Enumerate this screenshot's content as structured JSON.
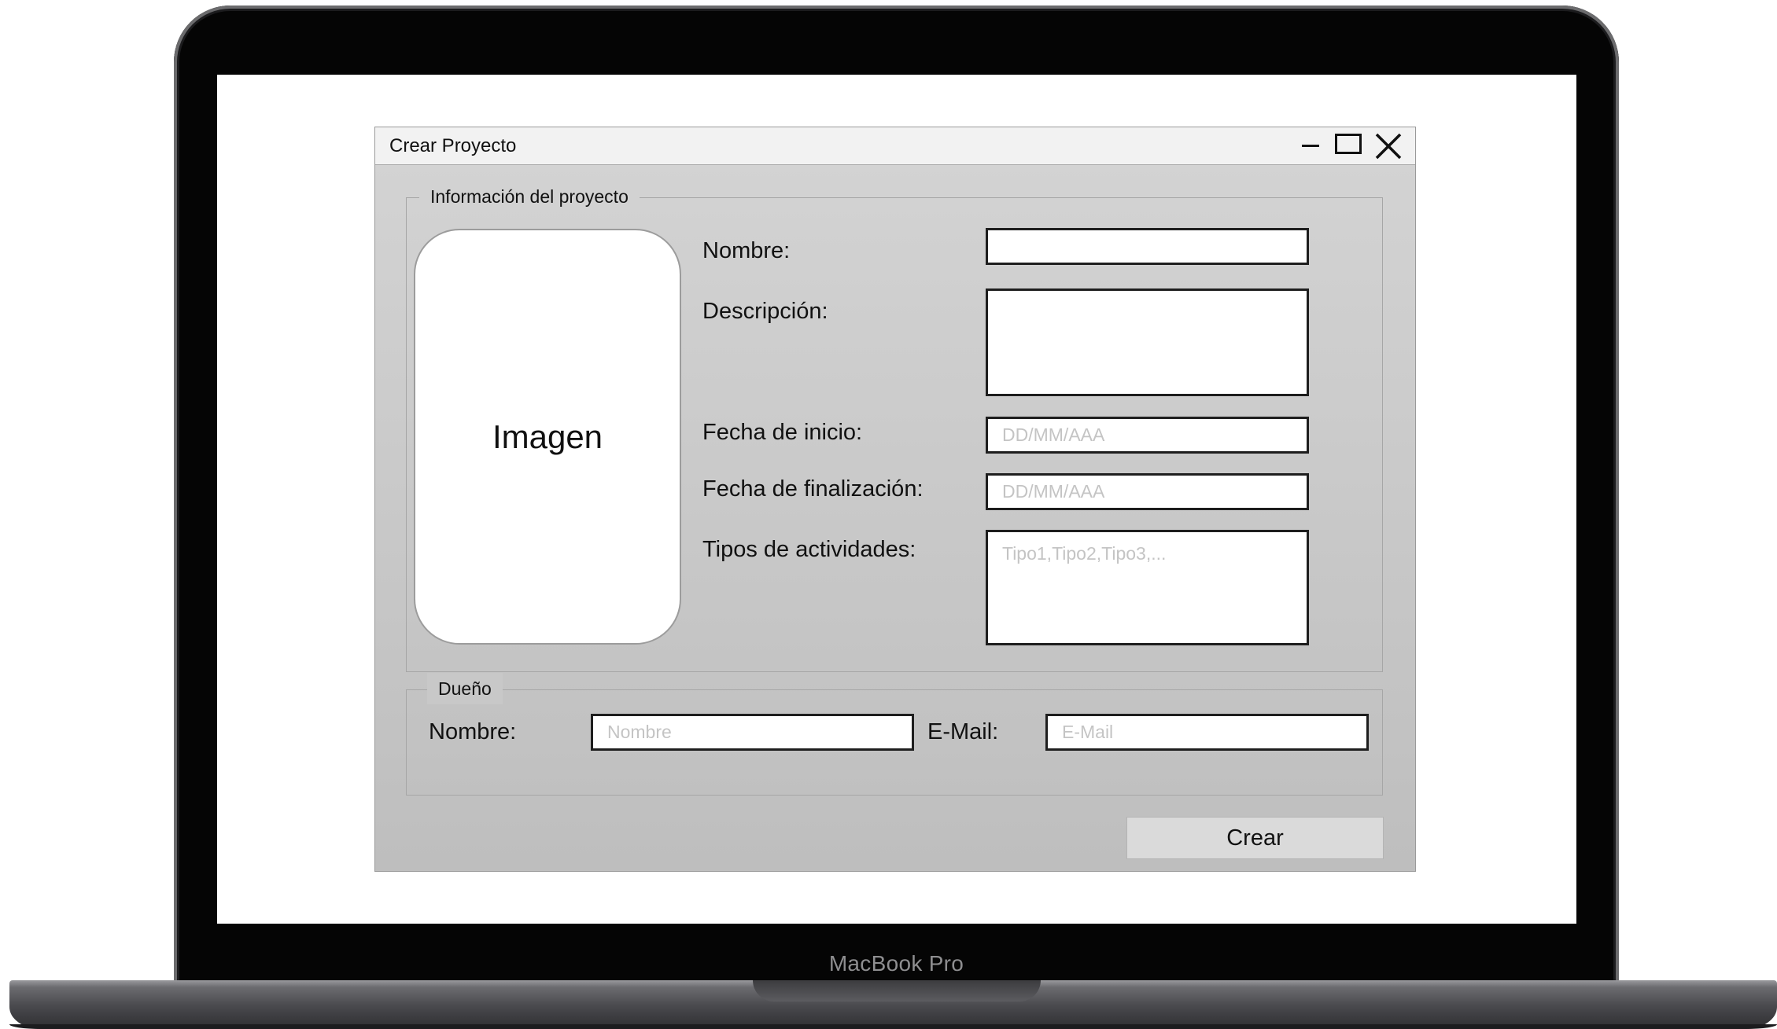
{
  "device": {
    "bezel_label": "MacBook Pro"
  },
  "window": {
    "title": "Crear Proyecto",
    "controls": [
      "minimize-icon",
      "maximize-icon",
      "close-icon"
    ]
  },
  "project_info": {
    "legend": "Información del proyecto",
    "image_label": "Imagen",
    "name_label": "Nombre:",
    "name_value": "",
    "description_label": "Descripción:",
    "description_value": "",
    "start_date_label": "Fecha de inicio:",
    "start_date_placeholder": "DD/MM/AAA",
    "end_date_label": "Fecha de finalización:",
    "end_date_placeholder": "DD/MM/AAA",
    "activity_types_label": "Tipos de actividades:",
    "activity_types_placeholder": "Tipo1,Tipo2,Tipo3,..."
  },
  "owner": {
    "legend": "Dueño",
    "name_label": "Nombre:",
    "name_placeholder": "Nombre",
    "email_label": "E-Mail:",
    "email_placeholder": "E-Mail"
  },
  "actions": {
    "create_label": "Crear"
  }
}
